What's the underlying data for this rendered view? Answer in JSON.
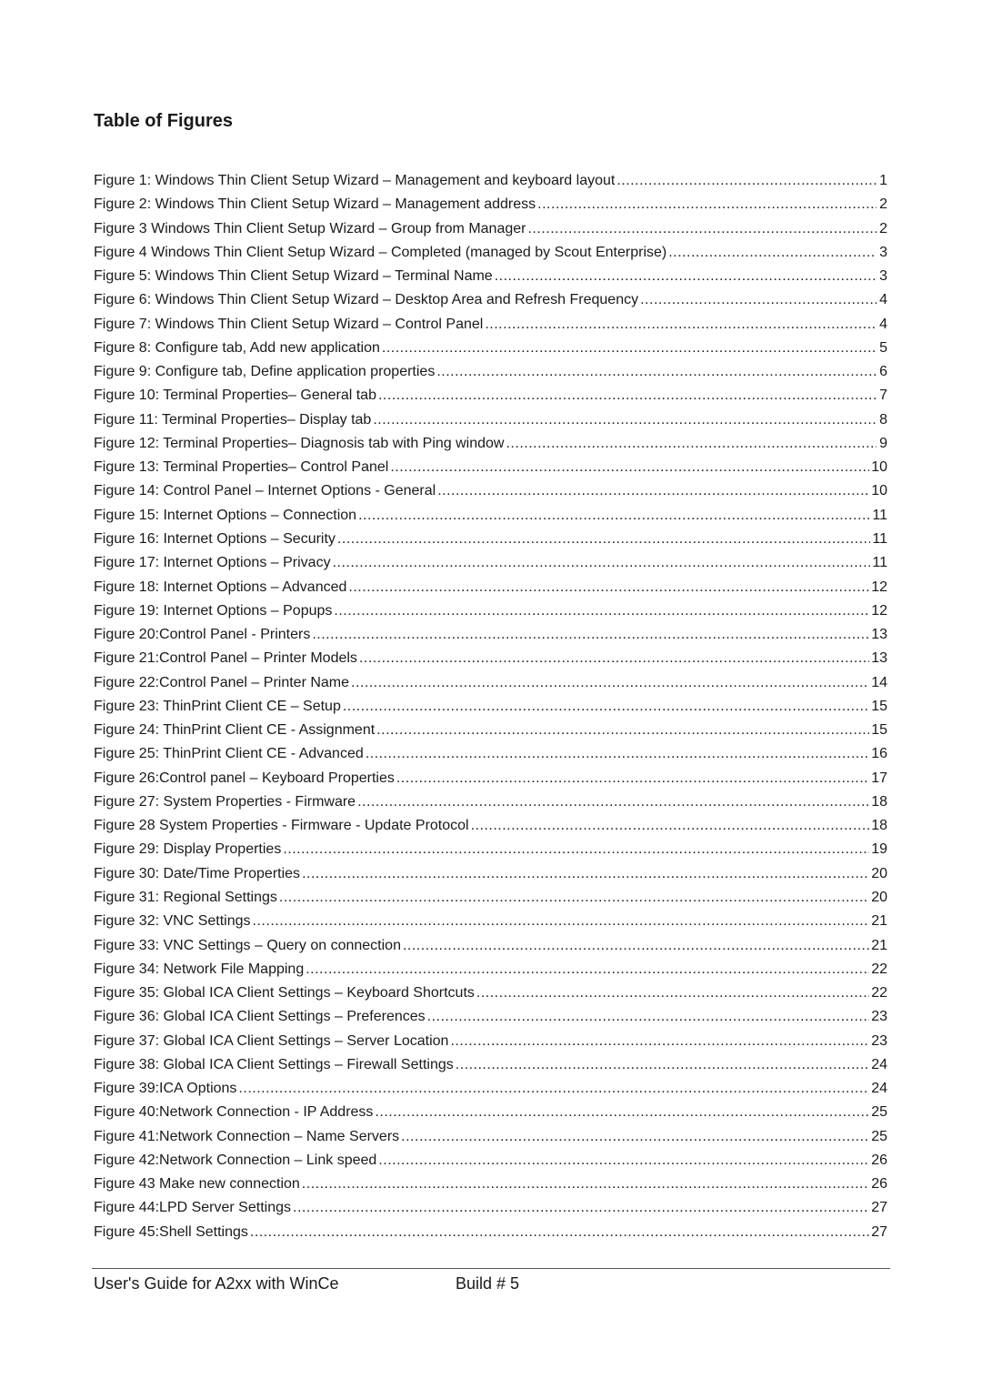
{
  "title": "Table of Figures",
  "entries": [
    {
      "label": "Figure 1: Windows Thin Client Setup Wizard – Management and keyboard layout",
      "page": "1"
    },
    {
      "label": "Figure 2: Windows Thin Client Setup Wizard – Management address",
      "page": "2"
    },
    {
      "label": "Figure 3 Windows Thin Client Setup Wizard – Group from Manager",
      "page": "2"
    },
    {
      "label": "Figure 4 Windows Thin Client Setup Wizard – Completed (managed by Scout Enterprise)",
      "page": "3"
    },
    {
      "label": "Figure 5: Windows Thin Client Setup Wizard – Terminal Name",
      "page": "3"
    },
    {
      "label": "Figure 6: Windows Thin Client Setup Wizard – Desktop Area and Refresh Frequency",
      "page": "4"
    },
    {
      "label": "Figure 7: Windows Thin Client Setup Wizard – Control Panel",
      "page": "4"
    },
    {
      "label": "Figure 8:  Configure tab, Add new application",
      "page": "5"
    },
    {
      "label": "Figure 9:  Configure tab, Define application properties",
      "page": "6"
    },
    {
      "label": "Figure 10:  Terminal Properties– General tab",
      "page": "7"
    },
    {
      "label": "Figure 11: Terminal Properties– Display tab",
      "page": "8"
    },
    {
      "label": "Figure 12: Terminal Properties– Diagnosis tab with Ping window",
      "page": "9"
    },
    {
      "label": "Figure 13: Terminal Properties– Control Panel",
      "page": "10"
    },
    {
      "label": "Figure 14: Control Panel – Internet Options - General",
      "page": "10"
    },
    {
      "label": "Figure 15: Internet Options – Connection",
      "page": "11"
    },
    {
      "label": "Figure 16: Internet Options – Security",
      "page": "11"
    },
    {
      "label": "Figure 17: Internet Options – Privacy",
      "page": "11"
    },
    {
      "label": "Figure 18: Internet Options – Advanced",
      "page": "12"
    },
    {
      "label": "Figure 19: Internet Options – Popups",
      "page": "12"
    },
    {
      "label": "Figure 20:Control Panel - Printers",
      "page": "13"
    },
    {
      "label": "Figure 21:Control Panel – Printer Models",
      "page": "13"
    },
    {
      "label": "Figure 22:Control Panel – Printer Name",
      "page": "14"
    },
    {
      "label": "Figure 23: ThinPrint Client CE – Setup",
      "page": "15"
    },
    {
      "label": "Figure 24: ThinPrint Client CE - Assignment",
      "page": "15"
    },
    {
      "label": "Figure 25: ThinPrint Client CE - Advanced",
      "page": "16"
    },
    {
      "label": "Figure 26:Control panel – Keyboard Properties",
      "page": "17"
    },
    {
      "label": "Figure 27: System Properties - Firmware",
      "page": "18"
    },
    {
      "label": "Figure 28 System Properties - Firmware - Update Protocol",
      "page": "18"
    },
    {
      "label": "Figure 29: Display Properties",
      "page": "19"
    },
    {
      "label": "Figure 30: Date/Time Properties",
      "page": "20"
    },
    {
      "label": "Figure 31: Regional Settings",
      "page": "20"
    },
    {
      "label": "Figure 32: VNC Settings",
      "page": "21"
    },
    {
      "label": "Figure 33: VNC Settings – Query on connection",
      "page": "21"
    },
    {
      "label": "Figure 34: Network File Mapping",
      "page": "22"
    },
    {
      "label": "Figure 35: Global ICA Client Settings – Keyboard Shortcuts",
      "page": "22"
    },
    {
      "label": "Figure 36: Global ICA Client Settings – Preferences",
      "page": "23"
    },
    {
      "label": "Figure 37: Global ICA Client Settings – Server Location",
      "page": "23"
    },
    {
      "label": "Figure 38: Global ICA Client Settings – Firewall Settings",
      "page": "24"
    },
    {
      "label": "Figure 39:ICA Options",
      "page": "24"
    },
    {
      "label": "Figure 40:Network Connection - IP Address",
      "page": "25"
    },
    {
      "label": "Figure 41:Network Connection – Name Servers",
      "page": "25"
    },
    {
      "label": "Figure 42:Network Connection – Link speed",
      "page": "26"
    },
    {
      "label": "Figure 43 Make new connection",
      "page": "26"
    },
    {
      "label": "Figure 44:LPD Server Settings",
      "page": "27"
    },
    {
      "label": "Figure 45:Shell Settings",
      "page": "27"
    }
  ],
  "footer": {
    "left": "User's Guide for A2xx with WinCe",
    "right": "Build # 5"
  }
}
